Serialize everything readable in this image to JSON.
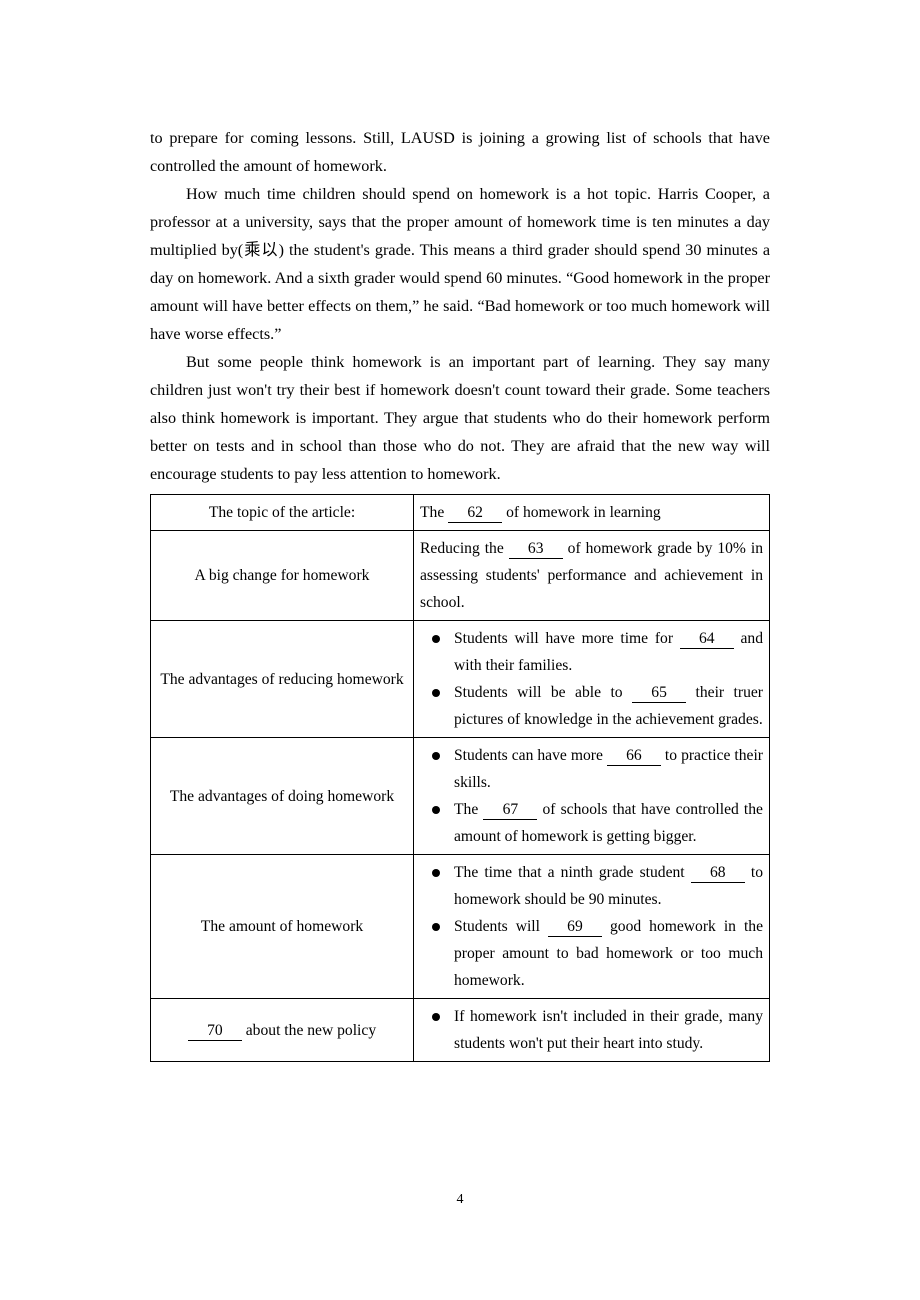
{
  "document": {
    "page_number": "4",
    "paragraphs": [
      "to prepare for coming lessons. Still, LAUSD is joining a growing list of schools that have controlled the amount of homework.",
      "How much time children should spend on homework is a hot topic. Harris Cooper, a professor at a university, says that the proper amount of homework time is ten minutes a day multiplied by(乘以) the student's grade. This means a third grader should spend 30 minutes a day on homework. And a sixth grader would spend 60 minutes. “Good homework in the proper amount will have better effects on them,” he said. “Bad homework or too much homework will have worse effects.”",
      "But some people think homework is an important part of learning. They say many children just won't try their best if homework doesn't count toward their grade. Some teachers also think homework is important. They argue that students who do their homework perform better on tests and in school than those who do not. They are afraid that the new way will encourage students to pay less attention to homework."
    ],
    "table": {
      "topic_row": {
        "label": "The topic of the article:",
        "prefix": "The",
        "blank": "62",
        "suffix": "of homework in learning"
      },
      "rows": [
        {
          "label": "A big change for homework",
          "type": "text",
          "text_parts": {
            "before": "Reducing the",
            "blank": "63",
            "after": "of homework grade by 10% in assessing students' performance and achievement in school."
          }
        },
        {
          "label": "The advantages of reducing homework",
          "type": "bullets",
          "bullets": [
            {
              "before": "Students will have more time for",
              "blank": "64",
              "after": "and with their families."
            },
            {
              "before": "Students will be able to",
              "blank": "65",
              "after": "their truer pictures of knowledge in the achievement grades."
            }
          ]
        },
        {
          "label": "The advantages of doing homework",
          "type": "bullets",
          "bullets": [
            {
              "before": "Students can have more",
              "blank": "66",
              "after": "to practice their skills."
            },
            {
              "before": "The",
              "blank": "67",
              "after": "of schools that have controlled the amount of homework is getting bigger."
            }
          ]
        },
        {
          "label": "The amount of homework",
          "type": "bullets",
          "bullets": [
            {
              "before": "The time that a ninth grade student",
              "blank": "68",
              "after": "to homework should be 90 minutes."
            },
            {
              "before": "Students will",
              "blank": "69",
              "after": "good homework in the proper amount to bad homework or too much homework."
            }
          ]
        },
        {
          "label_parts": {
            "blank": "70",
            "after": "about the new policy"
          },
          "type": "bullets",
          "bullets": [
            {
              "before": "If homework isn't included in their grade, many students won't put their heart into study.",
              "blank": "",
              "after": ""
            }
          ]
        }
      ]
    }
  }
}
